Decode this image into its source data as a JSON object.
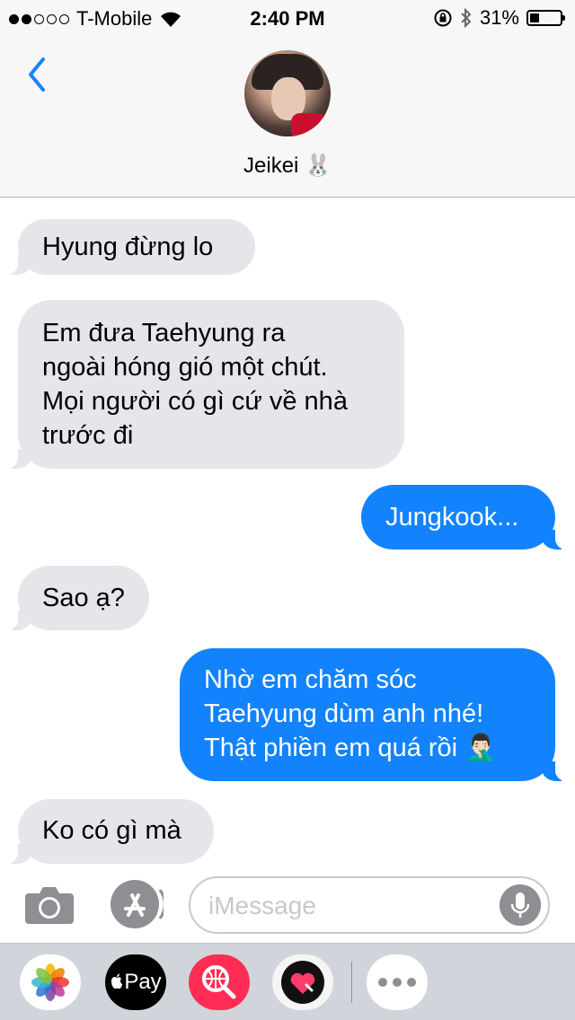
{
  "status_bar": {
    "signal_full": 2,
    "signal_empty": 3,
    "carrier": "T-Mobile",
    "time": "2:40 PM",
    "battery_percent": "31%",
    "battery_level": 0.31,
    "icons": [
      "signal-dots",
      "wifi-icon",
      "rotation-lock-icon",
      "bluetooth-icon",
      "battery-icon"
    ]
  },
  "header": {
    "back_icon": "chevron-left-icon",
    "contact_name": "Jeikei 🐰",
    "accent_color": "#1a82fb"
  },
  "messages": [
    {
      "direction": "incoming",
      "lines": [
        "Hyung đừng lo"
      ]
    },
    {
      "direction": "incoming",
      "lines": [
        "Em đưa Taehyung ra",
        "ngoài hóng gió một chút.",
        "Mọi người có gì cứ về nhà",
        "trước đi"
      ]
    },
    {
      "direction": "outgoing",
      "lines": [
        "Jungkook..."
      ]
    },
    {
      "direction": "incoming",
      "lines": [
        "Sao ạ?"
      ]
    },
    {
      "direction": "outgoing",
      "lines": [
        "Nhờ em chăm sóc",
        "Taehyung dùm anh nhé!",
        "Thật phiền em quá rồi 🤦🏻‍♂️"
      ]
    },
    {
      "direction": "incoming",
      "lines": [
        "Ko có gì mà"
      ]
    }
  ],
  "colors": {
    "incoming_bubble": "#e5e5ea",
    "outgoing_bubble": "#1283fc"
  },
  "input_bar": {
    "camera_icon": "camera-icon",
    "appstore_icon": "app-store-icon",
    "placeholder": "iMessage",
    "mic_icon": "microphone-icon"
  },
  "app_drawer": {
    "apps": [
      "photos-app-icon",
      "apple-pay-icon",
      "web-search-icon",
      "digital-touch-icon",
      "more-apps-icon"
    ],
    "pay_label": "Pay"
  }
}
